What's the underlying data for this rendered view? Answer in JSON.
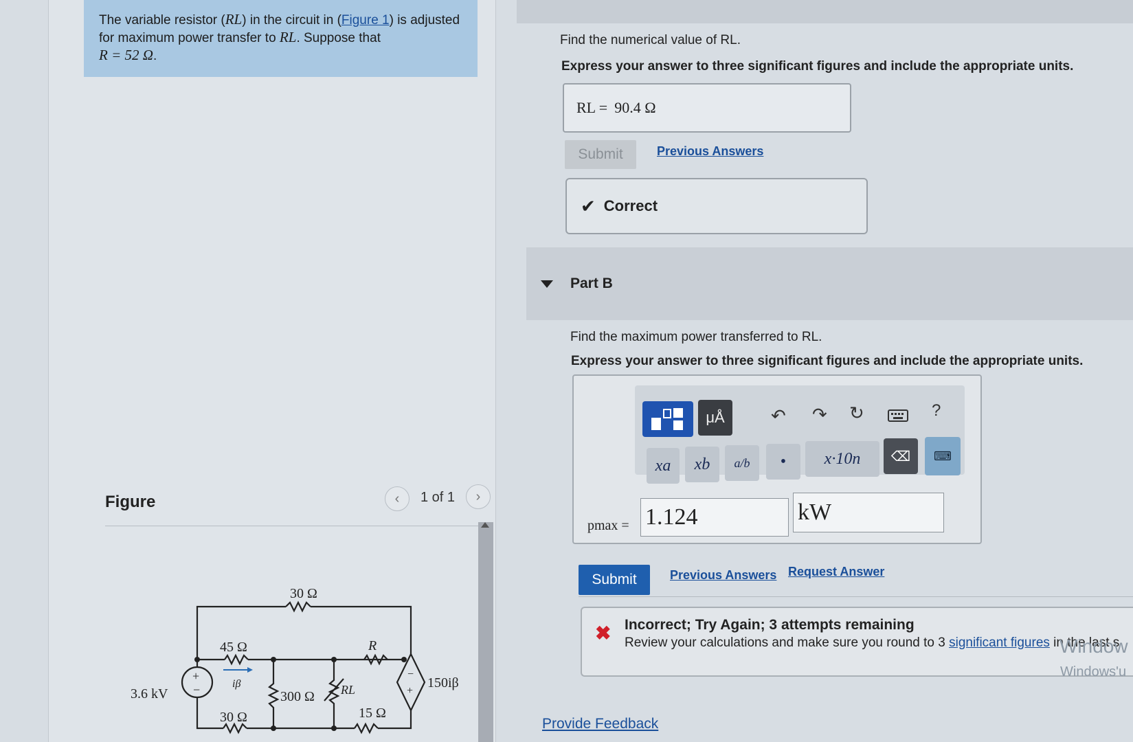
{
  "problem": {
    "text_1": "The variable resistor (",
    "var_rl": "RL",
    "text_2": ") in the circuit in (",
    "figure_link": "Figure 1",
    "text_3": ") is adjusted for maximum power transfer to ",
    "text_4": ". Suppose that ",
    "r_value": "R = 52  Ω",
    "text_5": "."
  },
  "figure": {
    "label": "Figure",
    "counter": "1 of 1",
    "prev_icon": "chevron-left-icon",
    "next_icon": "chevron-right-icon"
  },
  "circuit": {
    "source": "3.6 kV",
    "r_top": "30 Ω",
    "r_45": "45 Ω",
    "r_bottom_left": "30 Ω",
    "r_300": "300 Ω",
    "r_label": "R",
    "rl_label": "RL",
    "r_15": "15 Ω",
    "dependent_source": "150iβ",
    "current_label": "iβ",
    "plus": "+",
    "minus": "−"
  },
  "partA": {
    "prompt": "Find the numerical value of RL.",
    "instructions": "Express your answer to three significant figures and include the appropriate units.",
    "answer_label": "RL =",
    "answer_value": "90.4 Ω",
    "submit_label": "Submit",
    "previous_answers": "Previous Answers",
    "result": "Correct"
  },
  "partB": {
    "title": "Part B",
    "prompt": "Find the maximum power transferred to RL.",
    "instructions": "Express your answer to three significant figures and include the appropriate units.",
    "toolbar": {
      "templates_icon": "templates-icon",
      "units_label": "μÅ",
      "undo_icon": "undo-icon",
      "redo_icon": "redo-icon",
      "reset_icon": "reset-icon",
      "keyboard_icon": "keyboard-icon",
      "help_label": "?",
      "keys": [
        "xa",
        "xb",
        "a/b",
        "•",
        "x·10n"
      ],
      "backspace_icon": "backspace-icon"
    },
    "answer_label": "pmax =",
    "answer_value": "1.124",
    "answer_unit": "kW",
    "submit_label": "Submit",
    "previous_answers": "Previous Answers",
    "request_answer": "Request Answer",
    "feedback_title": "Incorrect; Try Again; 3 attempts remaining",
    "feedback_msg_1": "Review your calculations and make sure you round to 3 ",
    "feedback_link": "significant figures",
    "feedback_msg_2": " in the last s"
  },
  "watermark": {
    "line1": "Window",
    "line2": "Windows'u"
  },
  "footer": {
    "provide_feedback": "Provide Feedback"
  },
  "colors": {
    "problem_bg": "#a9c8e2",
    "link": "#1a4f9a",
    "submit_active": "#1f5fae",
    "error": "#d0202a"
  }
}
